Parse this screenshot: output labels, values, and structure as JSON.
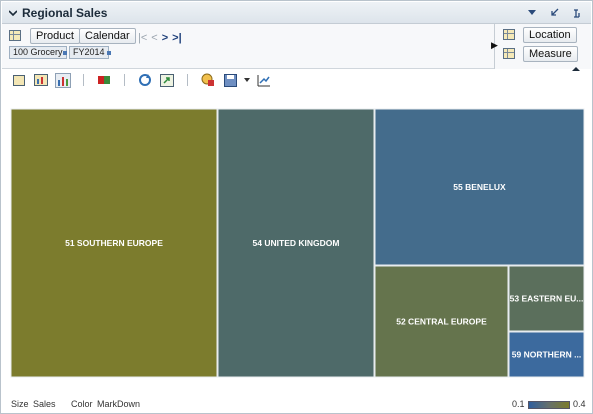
{
  "titlebar": {
    "title": "Regional Sales",
    "icons": [
      "collapse-icon",
      "dropdown-icon",
      "minimize-icon",
      "detach-icon"
    ]
  },
  "pivot": {
    "rows_label_1": "Product",
    "rows_label_2": "Calendar",
    "nav": [
      "|<",
      "<",
      ">",
      ">|"
    ],
    "filters": [
      "100 Grocery",
      "FY2014"
    ],
    "cols_label_1": "Location",
    "cols_label_2": "Measure"
  },
  "toolbar": {
    "icons": [
      "table-view-icon",
      "chart-table-view-icon",
      "chart-view-icon",
      "color-bar-icon",
      "refresh-icon",
      "export-icon",
      "options-icon",
      "save-icon",
      "format-icon"
    ]
  },
  "chart_data": {
    "type": "treemap",
    "size_measure": "Sales",
    "color_measure": "MarkDown",
    "color_range": [
      0.1,
      0.4
    ],
    "cells": [
      {
        "label": "51 SOUTHERN EUROPE",
        "color": "#7c7c2d"
      },
      {
        "label": "54 UNITED KINGDOM",
        "color": "#4e6a69"
      },
      {
        "label": "55 BENELUX",
        "color": "#446c8c"
      },
      {
        "label": "52 CENTRAL EUROPE",
        "color": "#65744d"
      },
      {
        "label": "53 EASTERN EU...",
        "color": "#5b6f5c"
      },
      {
        "label": "59 NORTHERN ...",
        "color": "#3c6a9e"
      }
    ]
  },
  "legend": {
    "size_label": "Size",
    "size_value": "Sales",
    "color_label": "Color",
    "color_value": "MarkDown",
    "scale_min": "0.1",
    "scale_max": "0.4"
  }
}
